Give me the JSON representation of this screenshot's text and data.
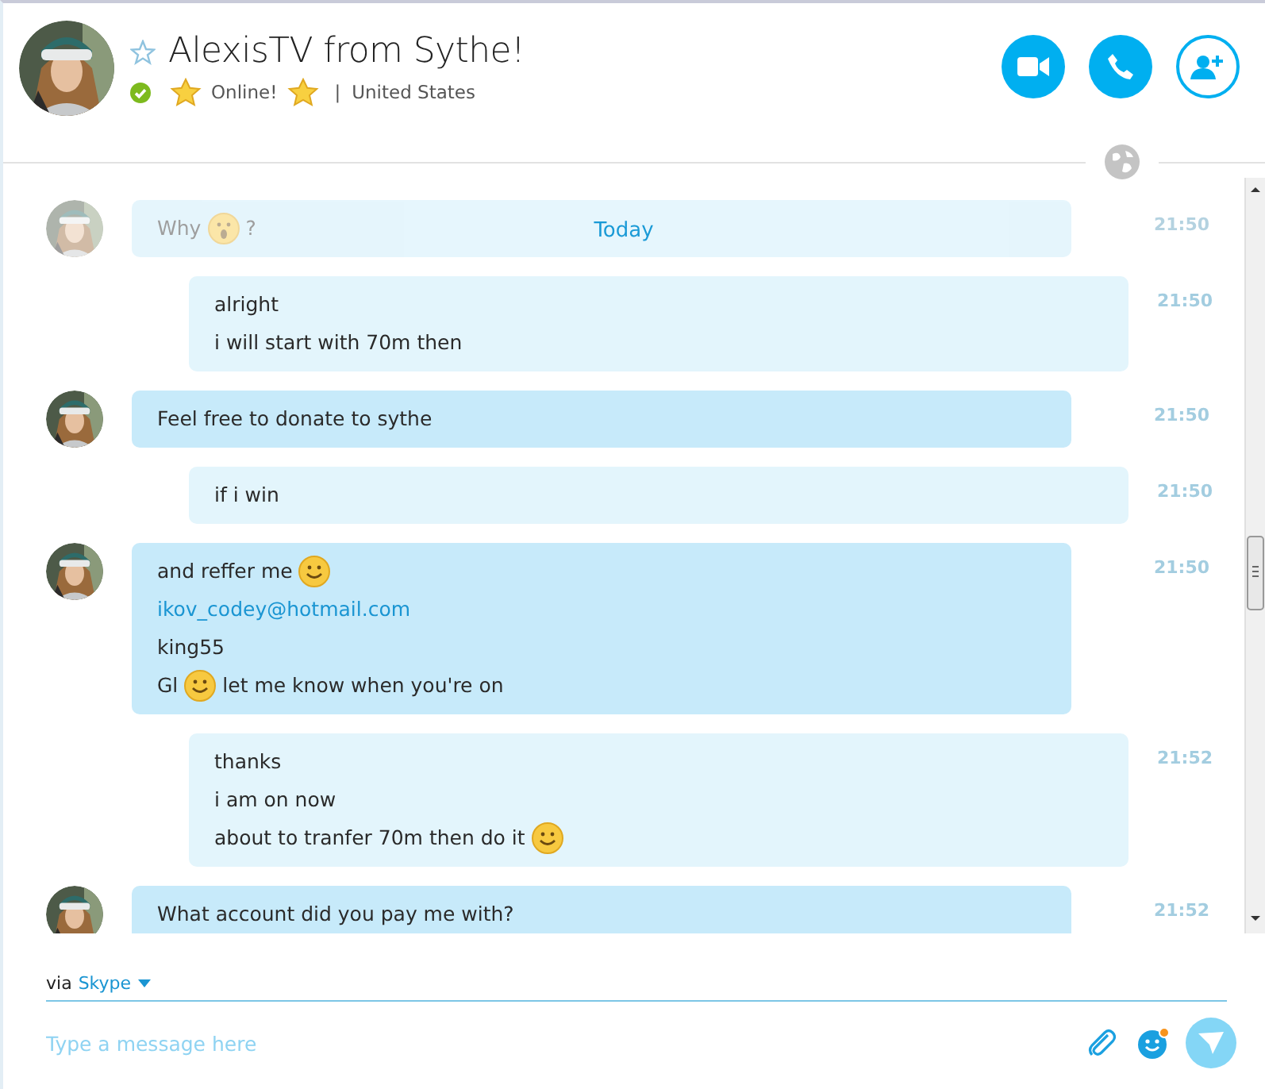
{
  "contact": {
    "name": "AlexisTV from Sythe!",
    "favorite": false,
    "online": true,
    "mood": [
      {
        "kind": "star"
      },
      {
        "kind": "text",
        "text": "Online!"
      },
      {
        "kind": "star"
      }
    ],
    "separator": "|",
    "location": "United States"
  },
  "date_separator": "Today",
  "messages": [
    {
      "kind": "incoming",
      "faded": true,
      "time": "21:50",
      "lines": [
        [
          {
            "kind": "text",
            "text": "Why"
          },
          {
            "kind": "surprised"
          },
          {
            "kind": "text",
            "text": "?"
          }
        ]
      ]
    },
    {
      "kind": "outgoing",
      "faded": false,
      "time": "21:50",
      "lines": [
        [
          {
            "kind": "text",
            "text": "alright"
          }
        ],
        [
          {
            "kind": "text",
            "text": "i will start with 70m then"
          }
        ]
      ]
    },
    {
      "kind": "incoming",
      "faded": false,
      "time": "21:50",
      "lines": [
        [
          {
            "kind": "text",
            "text": "Feel free to donate to sythe"
          }
        ]
      ]
    },
    {
      "kind": "outgoing",
      "faded": false,
      "time": "21:50",
      "lines": [
        [
          {
            "kind": "text",
            "text": "if i win"
          }
        ]
      ]
    },
    {
      "kind": "incoming",
      "faded": false,
      "time": "21:50",
      "lines": [
        [
          {
            "kind": "text",
            "text": "and reffer me"
          },
          {
            "kind": "smile"
          }
        ],
        [
          {
            "kind": "link",
            "text": "ikov_codey@hotmail.com"
          }
        ],
        [
          {
            "kind": "text",
            "text": "king55"
          }
        ],
        [
          {
            "kind": "text",
            "text": "Gl"
          },
          {
            "kind": "smile"
          },
          {
            "kind": "text",
            "text": "let me know when you're on"
          }
        ]
      ]
    },
    {
      "kind": "outgoing",
      "faded": false,
      "time": "21:52",
      "lines": [
        [
          {
            "kind": "text",
            "text": "thanks"
          }
        ],
        [
          {
            "kind": "text",
            "text": "i am on now"
          }
        ],
        [
          {
            "kind": "text",
            "text": "about to tranfer 70m then do it"
          },
          {
            "kind": "smile"
          }
        ]
      ]
    },
    {
      "kind": "incoming",
      "faded": false,
      "time": "21:52",
      "lines": [
        [
          {
            "kind": "text",
            "text": "What account did you pay me with?"
          }
        ]
      ]
    }
  ],
  "composer": {
    "via": "via",
    "service": "Skype",
    "placeholder": "Type a message here"
  }
}
